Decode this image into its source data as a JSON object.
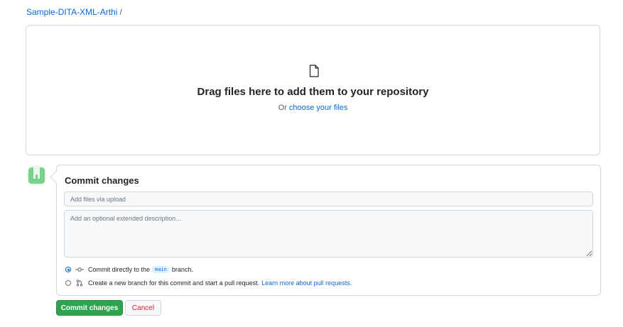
{
  "breadcrumb": {
    "repo": "Sample-DITA-XML-Arthi",
    "separator": "/"
  },
  "dropzone": {
    "icon": "file-icon",
    "title": "Drag files here to add them to your repository",
    "prefix": "Or",
    "choose_link": "choose your files"
  },
  "commit": {
    "title": "Commit changes",
    "summary_placeholder": "Add files via upload",
    "description_placeholder": "Add an optional extended description…",
    "option_direct": {
      "prefix": "Commit directly to the",
      "branch": "main",
      "suffix": "branch.",
      "selected": true,
      "icon": "git-commit-icon"
    },
    "option_new_branch": {
      "text": "Create a new branch for this commit and start a pull request.",
      "link": "Learn more about pull requests.",
      "selected": false,
      "icon": "git-pull-request-icon"
    }
  },
  "actions": {
    "commit_label": "Commit changes",
    "cancel_label": "Cancel"
  },
  "colors": {
    "link": "#0969da",
    "primary_button": "#2da44e",
    "danger_text": "#cf222e",
    "border": "#d0d7de",
    "avatar": "#7bd38b"
  }
}
